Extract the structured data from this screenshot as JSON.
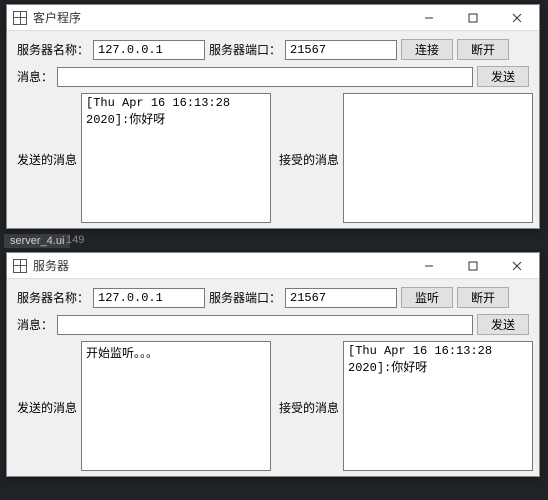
{
  "bg": {
    "file": "server_4.ui",
    "num": "149"
  },
  "windows": [
    {
      "title": "客户程序",
      "labels": {
        "server_name": "服务器名称：",
        "server_port": "服务器端口：",
        "message": "消息：",
        "sent": "发送的消息",
        "recv": "接受的消息"
      },
      "buttons": {
        "primary": "连接",
        "disconnect": "断开",
        "send": "发送"
      },
      "values": {
        "server_name": "127.0.0.1",
        "server_port": "21567",
        "message": ""
      },
      "sent_text": "[Thu Apr 16 16:13:28 2020]:你好呀",
      "recv_text": ""
    },
    {
      "title": "服务器",
      "labels": {
        "server_name": "服务器名称：",
        "server_port": "服务器端口：",
        "message": "消息：",
        "sent": "发送的消息",
        "recv": "接受的消息"
      },
      "buttons": {
        "primary": "监听",
        "disconnect": "断开",
        "send": "发送"
      },
      "values": {
        "server_name": "127.0.0.1",
        "server_port": "21567",
        "message": ""
      },
      "sent_text": "开始监听。。。",
      "recv_text": "[Thu Apr 16 16:13:28 2020]:你好呀"
    }
  ]
}
